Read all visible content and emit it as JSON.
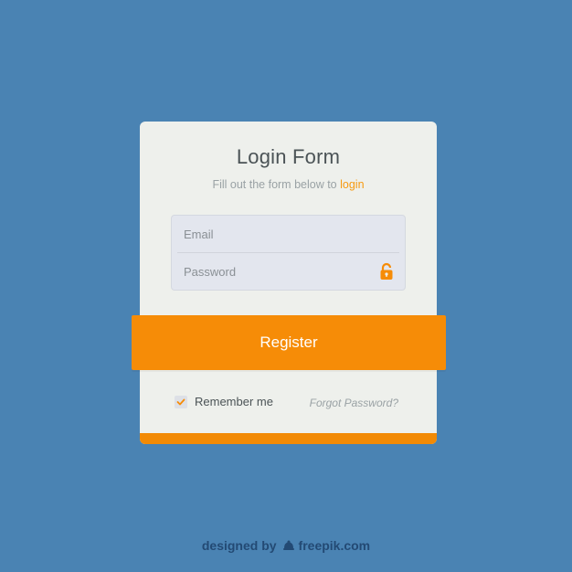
{
  "form": {
    "title": "Login Form",
    "subtitle_prefix": "Fill out the form below to ",
    "subtitle_link": "login",
    "email_placeholder": "Email",
    "password_placeholder": "Password",
    "register_label": "Register",
    "remember_label": "Remember me",
    "remember_checked": true,
    "forgot_label": "Forgot Password?"
  },
  "footer": {
    "designed_by": "designed by",
    "brand": "freepik.com"
  },
  "icons": {
    "lock": "lock-icon",
    "check": "checkmark-icon",
    "brand_logo": "freepik-logo-icon"
  },
  "colors": {
    "background": "#4a83b3",
    "card": "#eef0ec",
    "accent": "#f68c07",
    "title_text": "#4b5356",
    "muted_text": "#9aa2a5"
  }
}
